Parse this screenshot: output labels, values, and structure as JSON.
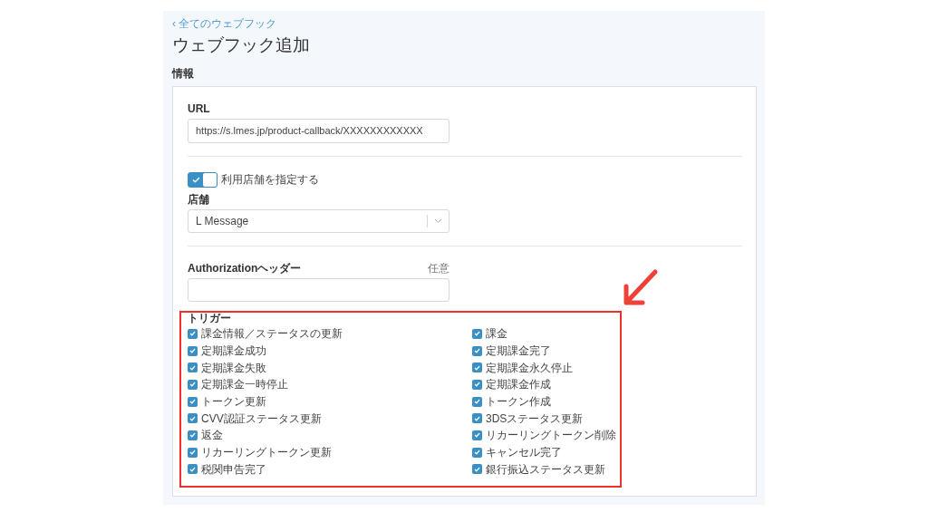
{
  "back_link": {
    "icon": "‹",
    "label": "全てのウェブフック"
  },
  "title": "ウェブフック追加",
  "section_label": "情報",
  "url": {
    "label": "URL",
    "value": "https://s.lmes.jp/product-callback/XXXXXXXXXXXX"
  },
  "store_toggle": {
    "label": "利用店舗を指定する",
    "on": true
  },
  "store": {
    "label": "店舗",
    "value": "L Message"
  },
  "auth_header": {
    "label": "Authorizationヘッダー",
    "hint": "任意"
  },
  "triggers": {
    "label": "トリガー",
    "items": [
      {
        "label": "課金情報／ステータスの更新",
        "checked": true
      },
      {
        "label": "課金",
        "checked": true
      },
      {
        "label": "定期課金成功",
        "checked": true
      },
      {
        "label": "定期課金完了",
        "checked": true
      },
      {
        "label": "定期課金失敗",
        "checked": true
      },
      {
        "label": "定期課金永久停止",
        "checked": true
      },
      {
        "label": "定期課金一時停止",
        "checked": true
      },
      {
        "label": "定期課金作成",
        "checked": true
      },
      {
        "label": "トークン更新",
        "checked": true
      },
      {
        "label": "トークン作成",
        "checked": true
      },
      {
        "label": "CVV認証ステータス更新",
        "checked": true
      },
      {
        "label": "3DSステータス更新",
        "checked": true
      },
      {
        "label": "返金",
        "checked": true
      },
      {
        "label": "リカーリングトークン削除",
        "checked": true
      },
      {
        "label": "リカーリングトークン更新",
        "checked": true
      },
      {
        "label": "キャンセル完了",
        "checked": true
      },
      {
        "label": "税関申告完了",
        "checked": true
      },
      {
        "label": "銀行振込ステータス更新",
        "checked": true
      }
    ]
  }
}
